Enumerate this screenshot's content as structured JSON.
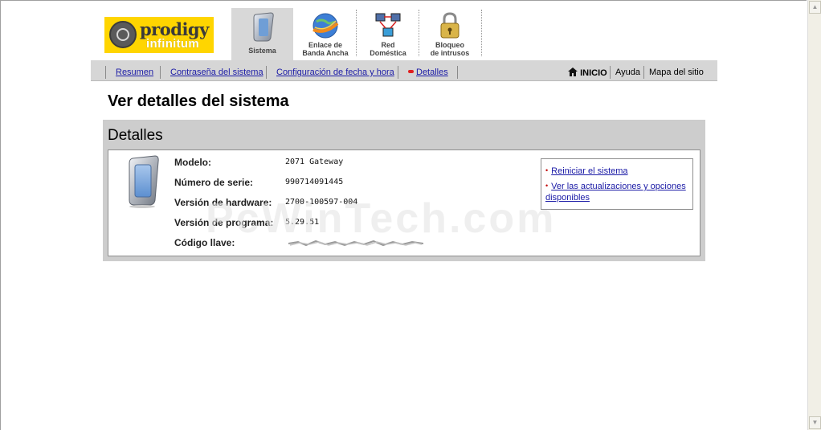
{
  "brand": {
    "name": "prodigy",
    "sub": "infinitum"
  },
  "tabs": [
    {
      "line1": "Sistema",
      "line2": "",
      "active": true,
      "icon": "system-device-icon"
    },
    {
      "line1": "Enlace de",
      "line2": "Banda Ancha",
      "active": false,
      "icon": "globe-icon"
    },
    {
      "line1": "Red",
      "line2": "Doméstica",
      "active": false,
      "icon": "network-icon"
    },
    {
      "line1": "Bloqueo",
      "line2": "de intrusos",
      "active": false,
      "icon": "padlock-icon"
    }
  ],
  "subnav": {
    "links": [
      "Resumen",
      "Contraseña del sistema",
      "Configuración de fecha y hora",
      "Detalles"
    ],
    "right": {
      "home": "INICIO",
      "help": "Ayuda",
      "sitemap": "Mapa del sitio"
    }
  },
  "page_title": "Ver detalles del sistema",
  "details": {
    "title": "Detalles",
    "rows": [
      {
        "label": "Modelo:",
        "value": "2071 Gateway"
      },
      {
        "label": "Número de serie:",
        "value": "990714091445"
      },
      {
        "label": "Versión de hardware:",
        "value": "2700-100597-004"
      },
      {
        "label": "Versión de programa:",
        "value": "5.29.51"
      },
      {
        "label": "Código llave:",
        "value": ""
      }
    ],
    "actions": [
      "Reiniciar el sistema",
      "Ver las actualizaciones y opciones disponibles"
    ]
  },
  "watermark": "PcWinTech.com",
  "colors": {
    "accent_yellow": "#ffd500",
    "link": "#1a1aa6",
    "bullet": "#c00000"
  }
}
